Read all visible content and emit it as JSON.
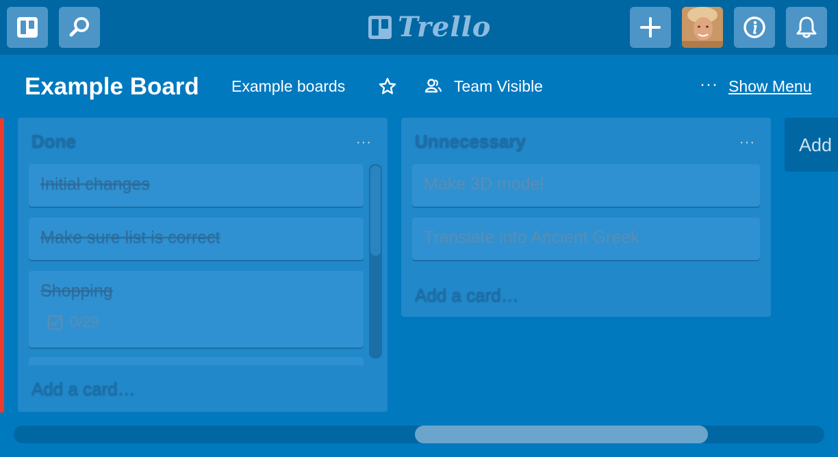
{
  "topbar": {
    "logo_text": "Trello",
    "icons": {
      "boards": "boards-icon",
      "search": "search-icon",
      "add": "plus-icon",
      "info": "info-icon",
      "notifications": "bell-icon"
    }
  },
  "board": {
    "title": "Example Board",
    "collection_link": "Example boards",
    "visibility": "Team Visible",
    "show_menu": "Show Menu"
  },
  "lists": [
    {
      "title": "Done",
      "cards": [
        {
          "title": "Initial changes"
        },
        {
          "title": "Make sure list is correct"
        },
        {
          "title": "Shopping",
          "checklist": "0/29"
        }
      ],
      "add_card": "Add a card…"
    },
    {
      "title": "Unnecessary",
      "cards": [
        {
          "title": "Make 3D model"
        },
        {
          "title": "Translate into Ancient Greek"
        }
      ],
      "add_card": "Add a card…"
    }
  ],
  "add_list_label": "Add",
  "colors": {
    "board_bg": "#0079bf",
    "topbar_bg": "#0067a3",
    "list_bg": "#2188c9",
    "card_bg": "#2f91d1",
    "label_red": "#eb3b2c"
  }
}
